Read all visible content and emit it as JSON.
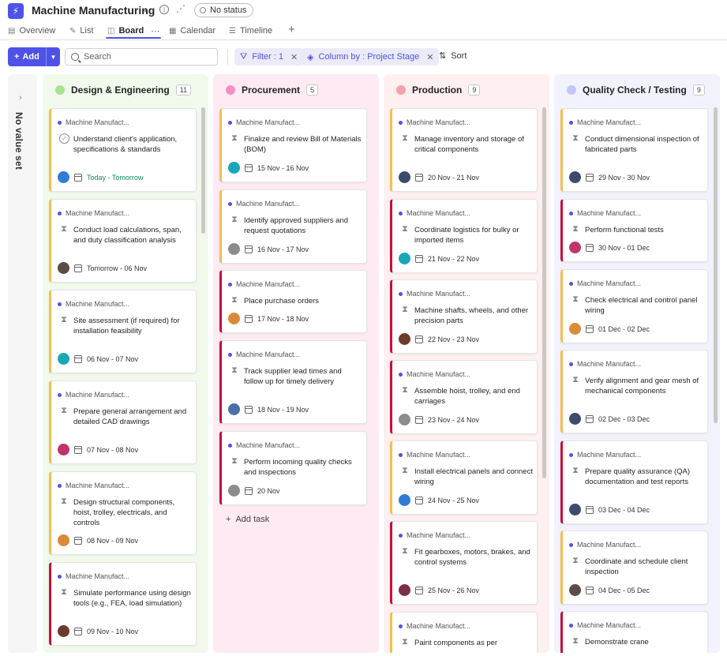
{
  "header": {
    "app_title": "Machine Manufacturing",
    "status": "No status"
  },
  "tabs": [
    {
      "label": "Overview",
      "icon": "clipboard-icon"
    },
    {
      "label": "List",
      "icon": "pin-icon"
    },
    {
      "label": "Board",
      "icon": "board-icon",
      "active": true
    },
    {
      "label": "Calendar",
      "icon": "calendar-icon"
    },
    {
      "label": "Timeline",
      "icon": "timeline-icon"
    }
  ],
  "toolbar": {
    "add_label": "Add",
    "search_placeholder": "Search",
    "filter_label": "Filter : 1",
    "column_label": "Column by : Project Stage",
    "sort_label": "Sort"
  },
  "colors": {
    "accent": "#4f52e8",
    "medium_priority": "#f4bf4f",
    "high_priority": "#c50f3c",
    "due_today": "#0e8a5f"
  },
  "no_value_column": "No value set",
  "add_task_label": "Add task",
  "columns": [
    {
      "name": "Design & Engineering",
      "count": "11",
      "dot_color": "#a6e38f",
      "bg": "#f1f9ec",
      "cards": [
        {
          "project": "Machine Manufact...",
          "title": "Understand client's application, specifications & standards",
          "date": "Today - Tomorrow",
          "status": "completed",
          "priority": "medium",
          "avatar": "#2f7bd6",
          "date_color": "green"
        },
        {
          "project": "Machine Manufact...",
          "title": "Conduct load calculations, span, and duty classification analysis",
          "date": "Tomorrow - 06 Nov",
          "status": "pending",
          "priority": "medium",
          "avatar": "#5a4d45"
        },
        {
          "project": "Machine Manufact...",
          "title": "Site assessment (if required) for installation feasibility",
          "date": "06 Nov - 07 Nov",
          "status": "pending",
          "priority": "medium",
          "avatar": "#1aa6b7"
        },
        {
          "project": "Machine Manufact...",
          "title": "Prepare general arrangement and detailed CAD drawings",
          "date": "07 Nov - 08 Nov",
          "status": "pending",
          "priority": "medium",
          "avatar": "#c0346e"
        },
        {
          "project": "Machine Manufact...",
          "title": "Design structural components, hoist, trolley, electricals, and controls",
          "date": "08 Nov - 09 Nov",
          "status": "pending",
          "priority": "medium",
          "avatar": "#d98b3a"
        },
        {
          "project": "Machine Manufact...",
          "title": "Simulate performance using design tools (e.g., FEA, load simulation)",
          "date": "09 Nov - 10 Nov",
          "status": "pending",
          "priority": "high",
          "avatar": "#6b3b2e"
        }
      ]
    },
    {
      "name": "Procurement",
      "count": "5",
      "dot_color": "#f48fc1",
      "bg": "#fdeaf3",
      "cards": [
        {
          "project": "Machine Manufact...",
          "title": "Finalize and review Bill of Materials (BOM)",
          "date": "15 Nov - 16 Nov",
          "status": "pending",
          "priority": "medium",
          "avatar": "#1aa6b7"
        },
        {
          "project": "Machine Manufact...",
          "title": "Identify approved suppliers and request quotations",
          "date": "16 Nov - 17 Nov",
          "status": "pending",
          "priority": "medium",
          "avatar": "#8c8c8c"
        },
        {
          "project": "Machine Manufact...",
          "title": "Place purchase orders",
          "date": "17 Nov - 18 Nov",
          "status": "pending",
          "priority": "high",
          "avatar": "#d98b3a"
        },
        {
          "project": "Machine Manufact...",
          "title": "Track supplier lead times and follow up for timely delivery",
          "date": "18 Nov - 19 Nov",
          "status": "pending",
          "priority": "high",
          "avatar": "#4a6fa5"
        },
        {
          "project": "Machine Manufact...",
          "title": "Perform incoming quality checks and inspections",
          "date": "20 Nov",
          "status": "pending",
          "priority": "high",
          "avatar": "#8c8c8c"
        }
      ]
    },
    {
      "name": "Production",
      "count": "9",
      "dot_color": "#f7a1a8",
      "bg": "#feeff0",
      "cards": [
        {
          "project": "Machine Manufact...",
          "title": "Manage inventory and storage of critical components",
          "date": "20 Nov - 21 Nov",
          "status": "pending",
          "priority": "medium",
          "avatar": "#3d4a6b"
        },
        {
          "project": "Machine Manufact...",
          "title": "Coordinate logistics for bulky or imported items",
          "date": "21 Nov - 22 Nov",
          "status": "pending",
          "priority": "high",
          "avatar": "#1aa6b7"
        },
        {
          "project": "Machine Manufact...",
          "title": "Machine shafts, wheels, and other precision parts",
          "date": "22 Nov - 23 Nov",
          "status": "pending",
          "priority": "high",
          "avatar": "#6b3b2e"
        },
        {
          "project": "Machine Manufact...",
          "title": "Assemble hoist, trolley, and end carriages",
          "date": "23 Nov - 24 Nov",
          "status": "pending",
          "priority": "high",
          "avatar": "#8c8c8c"
        },
        {
          "project": "Machine Manufact...",
          "title": "Install electrical panels and connect wiring",
          "date": "24 Nov - 25 Nov",
          "status": "pending",
          "priority": "medium",
          "avatar": "#2f7bd6"
        },
        {
          "project": "Machine Manufact...",
          "title": "Fit gearboxes, motors, brakes, and control systems",
          "date": "25 Nov - 26 Nov",
          "status": "pending",
          "priority": "high",
          "avatar": "#7a2e4a"
        },
        {
          "project": "Machine Manufact...",
          "title": "Paint components as per",
          "date": "",
          "status": "pending",
          "priority": "medium",
          "avatar": "#8c8c8c"
        }
      ]
    },
    {
      "name": "Quality Check / Testing",
      "count": "9",
      "dot_color": "#c4c6f5",
      "bg": "#f2f2fc",
      "cards": [
        {
          "project": "Machine Manufact...",
          "title": "Conduct dimensional inspection of fabricated parts",
          "date": "29 Nov - 30 Nov",
          "status": "pending",
          "priority": "medium",
          "avatar": "#3d4a6b"
        },
        {
          "project": "Machine Manufact...",
          "title": "Perform functional tests",
          "date": "30 Nov - 01 Dec",
          "status": "pending",
          "priority": "high",
          "avatar": "#c0346e"
        },
        {
          "project": "Machine Manufact...",
          "title": "Check electrical and control panel wiring",
          "date": "01 Dec - 02 Dec",
          "status": "pending",
          "priority": "medium",
          "avatar": "#d98b3a"
        },
        {
          "project": "Machine Manufact...",
          "title": "Verify alignment and gear mesh of mechanical components",
          "date": "02 Dec - 03 Dec",
          "status": "pending",
          "priority": "medium",
          "avatar": "#3d4a6b"
        },
        {
          "project": "Machine Manufact...",
          "title": "Prepare quality assurance (QA) documentation and test reports",
          "date": "03 Dec - 04 Dec",
          "status": "pending",
          "priority": "high",
          "avatar": "#3d4a6b"
        },
        {
          "project": "Machine Manufact...",
          "title": "Coordinate and schedule client inspection",
          "date": "04 Dec - 05 Dec",
          "status": "pending",
          "priority": "medium",
          "avatar": "#5a4d45"
        },
        {
          "project": "Machine Manufact...",
          "title": "Demonstrate crane",
          "date": "",
          "status": "pending",
          "priority": "high",
          "avatar": "#8c8c8c"
        }
      ]
    }
  ]
}
